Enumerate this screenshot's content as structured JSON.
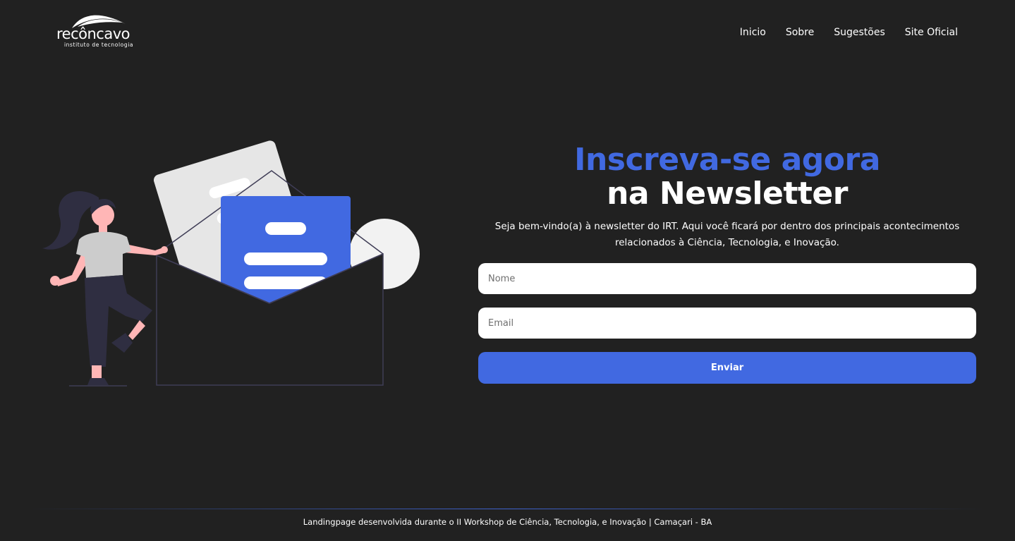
{
  "header": {
    "logo": {
      "name": "recôncavo",
      "subtitle": "instituto de tecnologia"
    },
    "nav": [
      {
        "label": "Inicio"
      },
      {
        "label": "Sobre"
      },
      {
        "label": "Sugestões"
      },
      {
        "label": "Site Oficial"
      }
    ]
  },
  "hero": {
    "title_line1": "Inscreva-se agora",
    "title_line2": "na Newsletter",
    "description": "Seja bem-vindo(a) à newsletter do IRT. Aqui você ficará por dentro dos principais acontecimentos relacionados à Ciência, Tecnologia, e Inovação."
  },
  "form": {
    "name_placeholder": "Nome",
    "email_placeholder": "Email",
    "submit_label": "Enviar"
  },
  "footer": {
    "text": "Landingpage desenvolvida durante o II Workshop de Ciência, Tecnologia, e Inovação | Camaçari - BA"
  },
  "colors": {
    "background": "#212121",
    "accent": "#4169e1",
    "text": "#ffffff"
  }
}
